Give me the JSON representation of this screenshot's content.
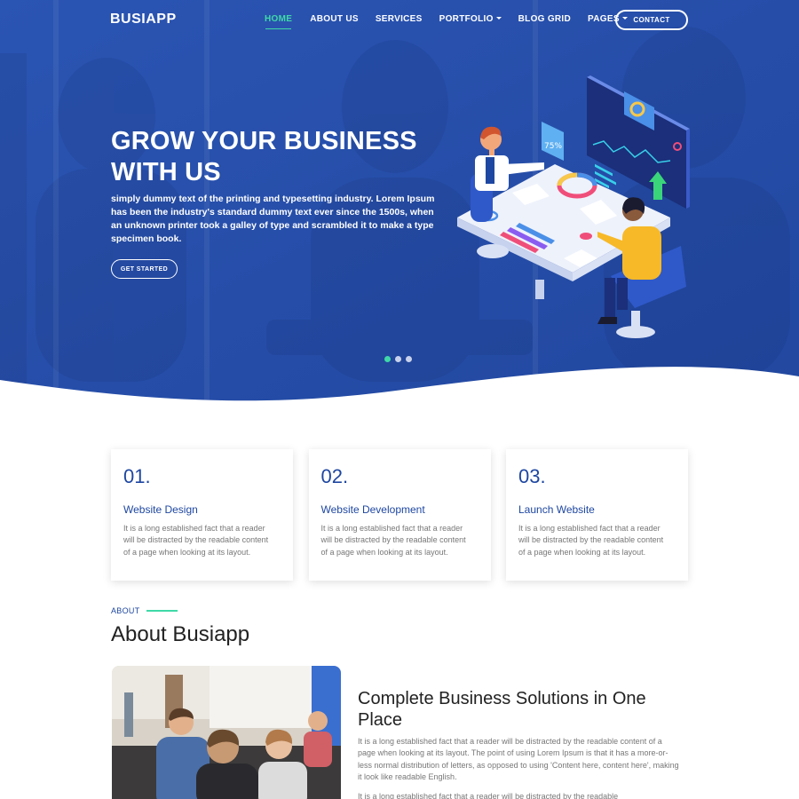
{
  "colors": {
    "brand_blue": "#1e47a1",
    "accent_green": "#3fd9a7",
    "white": "#ffffff"
  },
  "nav": {
    "logo": "BUSIAPP",
    "items": [
      {
        "label": "HOME",
        "active": true
      },
      {
        "label": "ABOUT US"
      },
      {
        "label": "SERVICES"
      },
      {
        "label": "PORTFOLIO",
        "dropdown": true
      },
      {
        "label": "BLOG GRID"
      },
      {
        "label": "PAGES",
        "dropdown": true
      }
    ],
    "contact_label": "CONTACT"
  },
  "hero": {
    "title": "GROW YOUR BUSINESS WITH US",
    "text": "simply dummy text of the printing and typesetting industry. Lorem Ipsum has been the industry's standard dummy text ever since the 1500s, when an unknown printer took a galley of type and scrambled it to make a type specimen book.",
    "button_label": "GET STARTED",
    "slider_dots": 3,
    "active_dot": 0,
    "illustration_badge": "75%"
  },
  "steps": [
    {
      "number": "01.",
      "title": "Website Design",
      "desc": "It is a long established fact that a reader will be distracted by the readable content of a page when looking at its layout."
    },
    {
      "number": "02.",
      "title": "Website Development",
      "desc": "It is a long established fact that a reader will be distracted by the readable content of a page when looking at its layout."
    },
    {
      "number": "03.",
      "title": "Launch Website",
      "desc": "It is a long established fact that a reader will be distracted by the readable content of a page when looking at its layout."
    }
  ],
  "about": {
    "label": "ABOUT",
    "title": "About Busiapp",
    "subtitle": "Complete Business Solutions in One Place",
    "text": "It is a long established fact that a reader will be distracted by the readable content of a page when looking at its layout. The point of using Lorem Ipsum is that it has a more-or-less normal distribution of letters, as opposed to using 'Content here, content here', making it look like readable English.",
    "text2": "It is a long established fact that a reader will be distracted by the readable"
  }
}
